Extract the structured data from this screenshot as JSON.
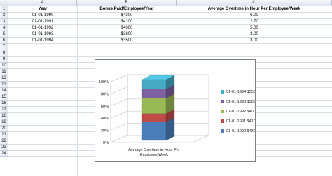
{
  "columns": [
    {
      "letter": "A"
    },
    {
      "letter": "B"
    },
    {
      "letter": "C"
    }
  ],
  "rows": [
    "1",
    "2",
    "3",
    "4",
    "5",
    "6",
    "7",
    "8",
    "9",
    "10",
    "11",
    "12",
    "13",
    "14",
    "15",
    "16",
    "17",
    "18",
    "19",
    "20",
    "21",
    "22",
    "23",
    "24"
  ],
  "table": {
    "headers": [
      "Year",
      "Bonus Paid/Employee/Year",
      "Average Overtime in Hour Per Employee/Week"
    ],
    "data": [
      [
        "01-01-1990",
        "$4300",
        "6.00"
      ],
      [
        "01-01-1991",
        "$4100",
        "2.70"
      ],
      [
        "01-01-1992",
        "$4000",
        "5.00"
      ],
      [
        "01-01-1993",
        "$3800",
        "3.00"
      ],
      [
        "01-01-1994",
        "$3500",
        "3.00"
      ]
    ]
  },
  "chart_data": {
    "type": "bar",
    "stacked": "percent",
    "three_d": true,
    "categories": [
      "Average Overtime in Hour Per Employee/Week"
    ],
    "category_label_lines": [
      "Average Overtime in Hour Per",
      "Employee/Week"
    ],
    "series": [
      {
        "name": "01-01-1990 $4300",
        "values": [
          6.0
        ],
        "color": "#4a7ebb"
      },
      {
        "name": "01-01-1991 $4100",
        "values": [
          2.7
        ],
        "color": "#be4b48"
      },
      {
        "name": "01-01-1992 $4000",
        "values": [
          5.0
        ],
        "color": "#98b954"
      },
      {
        "name": "01-01-1993 $3800",
        "values": [
          3.0
        ],
        "color": "#7d60a0"
      },
      {
        "name": "01-01-1994 $3500",
        "values": [
          3.0
        ],
        "color": "#46aac5"
      }
    ],
    "yticks": [
      "0%",
      "20%",
      "40%",
      "60%",
      "80%",
      "100%"
    ],
    "ylim": [
      0,
      100
    ],
    "legend_position": "right",
    "grid": true
  }
}
